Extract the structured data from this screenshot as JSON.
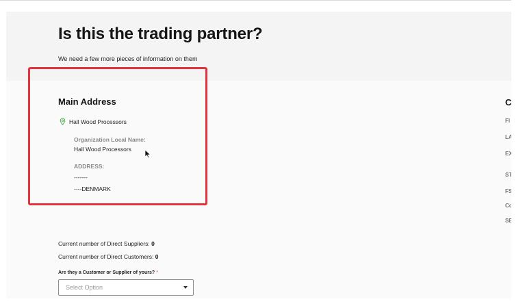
{
  "header": {
    "title": "Is this the trading partner?",
    "subtitle": "We need a few more pieces of information on them"
  },
  "main_address": {
    "section_title": "Main Address",
    "location_name": "Hall Wood Processors",
    "org_local_name_label": "Organization Local Name:",
    "org_local_name_value": "Hall Wood Processors",
    "address_label": "ADDRESS:",
    "address_line1": "-------",
    "address_line2": "----DENMARK"
  },
  "right_column": {
    "title_fragment": "C",
    "items": [
      "FI",
      "LA",
      "EX",
      "ST",
      "FS",
      "Co",
      "SE"
    ]
  },
  "stats": {
    "suppliers_label": "Current number of Direct Suppliers:",
    "suppliers_value": "0",
    "customers_label": "Current number of Direct Customers:",
    "customers_value": "0"
  },
  "relationship": {
    "question": "Are they a Customer or Supplier of yours?",
    "required_marker": "*",
    "select_placeholder": "Select Option"
  },
  "colors": {
    "highlight": "#e3343e",
    "pin": "#5cb85c"
  },
  "icons": {
    "location": "location-pin-icon",
    "dropdown": "chevron-down-icon",
    "cursor": "mouse-cursor-icon"
  }
}
